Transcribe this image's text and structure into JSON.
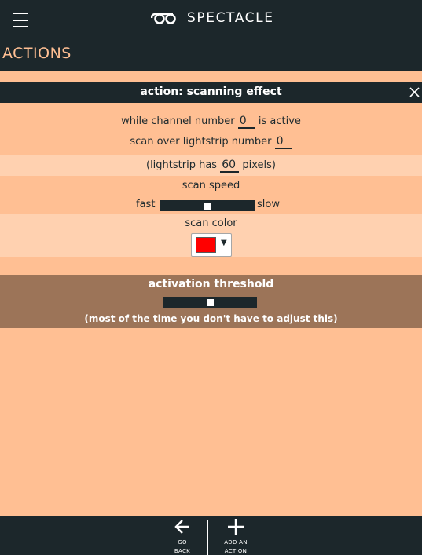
{
  "header": {
    "brand_name": "SPECTACLE",
    "section_title": "ACTIONS"
  },
  "panel": {
    "title": "action: scanning effect"
  },
  "form": {
    "channel_prefix": "while channel number",
    "channel_value": "0",
    "channel_suffix": "is active",
    "strip_prefix": "scan over lightstrip number",
    "strip_value": "0",
    "pixels_prefix": "(lightstrip has",
    "pixels_value": "60",
    "pixels_suffix": "pixels)",
    "speed_label": "scan speed",
    "speed_fast_label": "fast",
    "speed_slow_label": "slow",
    "speed_level": 0.5,
    "color_label": "scan color",
    "color_value": "#ff0000"
  },
  "threshold": {
    "title": "activation threshold",
    "level": 0.5,
    "note": "(most of the time you don't have to adjust this)"
  },
  "footer": {
    "back_label_line1": "GO",
    "back_label_line2": "BACK",
    "add_label_line1": "ADD AN",
    "add_label_line2": "ACTION"
  },
  "colors": {
    "background": "#ffbf93",
    "dark": "#1c272b",
    "accent": "#ffbf93",
    "row_highlight": "#ffd1b0",
    "threshold_bg": "#9c7458"
  },
  "icons": {
    "menu": "hamburger-icon",
    "logo": "glasses-logo",
    "close": "close-icon",
    "back": "arrow-left-icon",
    "add": "plus-icon",
    "dropdown": "caret-down-icon"
  }
}
